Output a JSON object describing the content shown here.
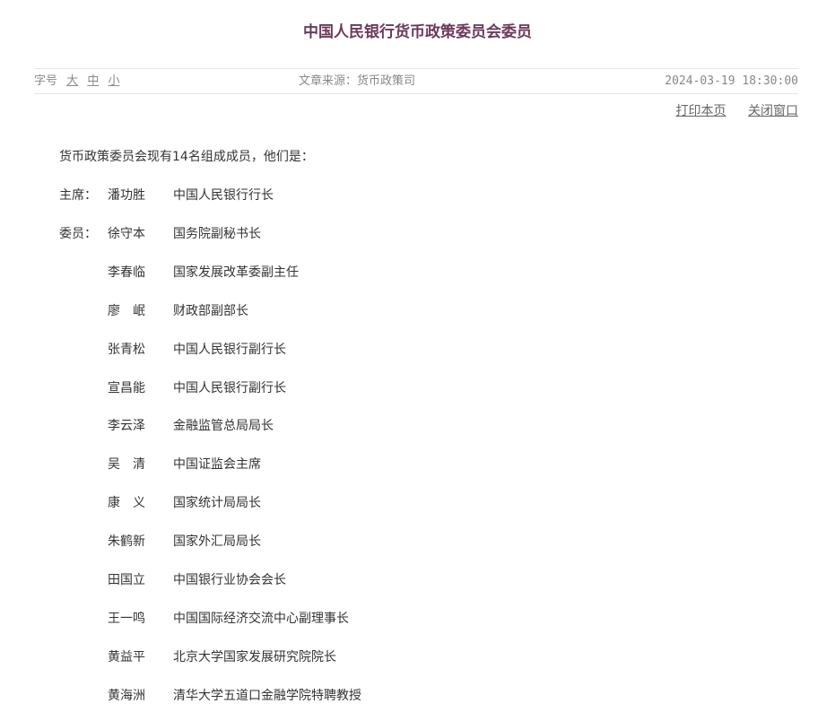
{
  "article": {
    "title": "中国人民银行货币政策委员会委员",
    "font_size_label": "字号",
    "font_size_options": [
      "大",
      "中",
      "小"
    ],
    "source": "文章来源：货币政策司",
    "date": "2024-03-19 18:30:00",
    "actions": {
      "print": "打印本页",
      "close": "关闭窗口"
    },
    "intro": "货币政策委员会现有14名组成成员，他们是：",
    "members": [
      {
        "role": "主席：",
        "name": "潘功胜",
        "position": "中国人民银行行长"
      },
      {
        "role": "委员：",
        "name": "徐守本",
        "position": "国务院副秘书长"
      },
      {
        "role": "",
        "name": "李春临",
        "position": "国家发展改革委副主任"
      },
      {
        "role": "",
        "name": "廖　岷",
        "position": "财政部副部长"
      },
      {
        "role": "",
        "name": "张青松",
        "position": "中国人民银行副行长"
      },
      {
        "role": "",
        "name": "宣昌能",
        "position": "中国人民银行副行长"
      },
      {
        "role": "",
        "name": "李云泽",
        "position": "金融监管总局局长"
      },
      {
        "role": "",
        "name": "吴　清",
        "position": "中国证监会主席"
      },
      {
        "role": "",
        "name": "康　义",
        "position": "国家统计局局长"
      },
      {
        "role": "",
        "name": "朱鹤新",
        "position": "国家外汇局局长"
      },
      {
        "role": "",
        "name": "田国立",
        "position": "中国银行业协会会长"
      },
      {
        "role": "",
        "name": "王一鸣",
        "position": "中国国际经济交流中心副理事长"
      },
      {
        "role": "",
        "name": "黄益平",
        "position": "北京大学国家发展研究院院长"
      },
      {
        "role": "",
        "name": "黄海洲",
        "position": "清华大学五道口金融学院特聘教授"
      }
    ]
  }
}
